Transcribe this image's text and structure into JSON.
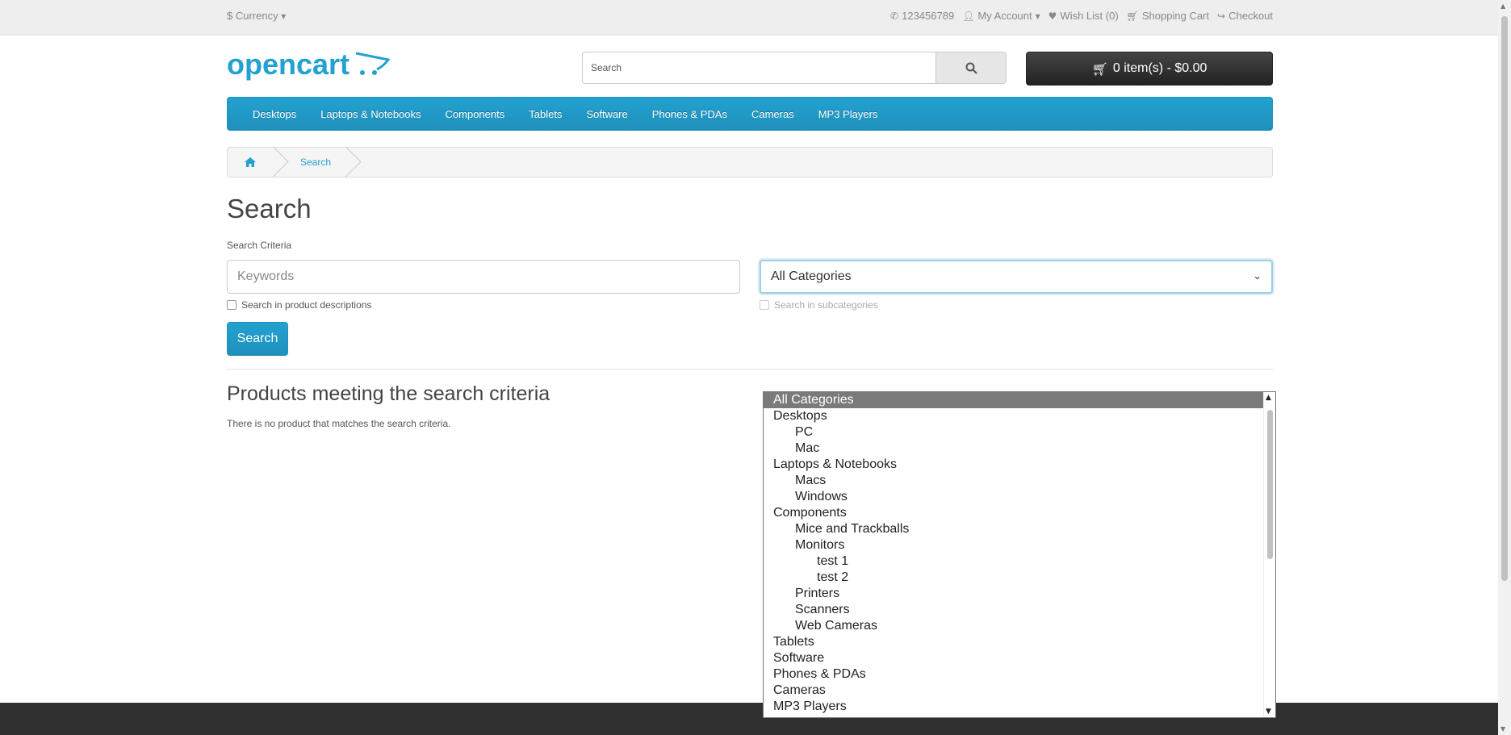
{
  "topbar": {
    "currency_label": "$ Currency",
    "phone": "123456789",
    "my_account": "My Account",
    "wish_list": "Wish List (0)",
    "shopping_cart": "Shopping Cart",
    "checkout": "Checkout"
  },
  "header": {
    "logo_text": "opencart",
    "search_placeholder": "Search",
    "cart_label": "0 item(s) - $0.00"
  },
  "menu": {
    "items": [
      "Desktops",
      "Laptops & Notebooks",
      "Components",
      "Tablets",
      "Software",
      "Phones & PDAs",
      "Cameras",
      "MP3 Players"
    ]
  },
  "breadcrumb": {
    "current": "Search"
  },
  "page": {
    "title": "Search",
    "criteria_label": "Search Criteria",
    "keywords_placeholder": "Keywords",
    "category_selected": "All Categories",
    "desc_checkbox_label": "Search in product descriptions",
    "sub_checkbox_label": "Search in subcategories",
    "search_button": "Search",
    "products_title": "Products meeting the search criteria",
    "no_results": "There is no product that matches the search criteria."
  },
  "category_options": [
    {
      "label": "All Categories",
      "level": 1,
      "selected": true
    },
    {
      "label": "Desktops",
      "level": 1
    },
    {
      "label": "PC",
      "level": 2
    },
    {
      "label": "Mac",
      "level": 2
    },
    {
      "label": "Laptops & Notebooks",
      "level": 1
    },
    {
      "label": "Macs",
      "level": 2
    },
    {
      "label": "Windows",
      "level": 2
    },
    {
      "label": "Components",
      "level": 1
    },
    {
      "label": "Mice and Trackballs",
      "level": 2
    },
    {
      "label": "Monitors",
      "level": 2
    },
    {
      "label": "test 1",
      "level": 3
    },
    {
      "label": "test 2",
      "level": 3
    },
    {
      "label": "Printers",
      "level": 2
    },
    {
      "label": "Scanners",
      "level": 2
    },
    {
      "label": "Web Cameras",
      "level": 2
    },
    {
      "label": "Tablets",
      "level": 1
    },
    {
      "label": "Software",
      "level": 1
    },
    {
      "label": "Phones & PDAs",
      "level": 1
    },
    {
      "label": "Cameras",
      "level": 1
    },
    {
      "label": "MP3 Players",
      "level": 1
    }
  ],
  "colors": {
    "accent": "#23a1d1",
    "dark": "#222222",
    "footer": "#303030"
  }
}
